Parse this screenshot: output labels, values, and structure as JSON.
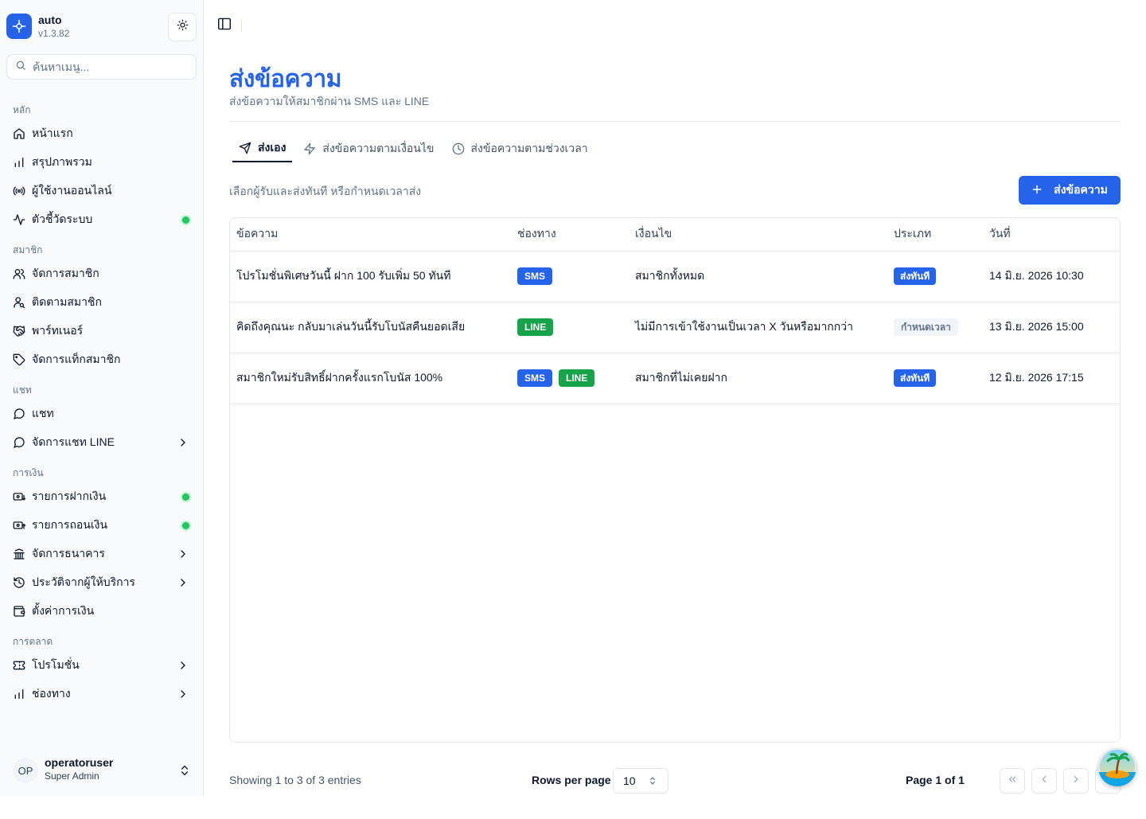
{
  "app": {
    "name": "auto",
    "version": "v1.3.82"
  },
  "search": {
    "placeholder": "ค้นหาเมนู..."
  },
  "sidebar": {
    "sections": [
      {
        "label": "หลัก",
        "items": [
          {
            "label": "หน้าแรก",
            "icon": "home-icon"
          },
          {
            "label": "สรุปภาพรวม",
            "icon": "bar-chart-icon"
          },
          {
            "label": "ผู้ใช้งานออนไลน์",
            "icon": "radio-icon"
          },
          {
            "label": "ตัวชี้วัดระบบ",
            "icon": "activity-icon",
            "status_dot": true
          }
        ]
      },
      {
        "label": "สมาชิก",
        "items": [
          {
            "label": "จัดการสมาชิก",
            "icon": "users-icon"
          },
          {
            "label": "ติดตามสมาชิก",
            "icon": "user-search-icon"
          },
          {
            "label": "พาร์ทเนอร์",
            "icon": "handshake-icon"
          },
          {
            "label": "จัดการแท็กสมาชิก",
            "icon": "tag-icon"
          }
        ]
      },
      {
        "label": "แชท",
        "items": [
          {
            "label": "แชท",
            "icon": "message-circle-icon"
          },
          {
            "label": "จัดการแชท LINE",
            "icon": "message-circle-icon",
            "chevron": true
          }
        ]
      },
      {
        "label": "การเงิน",
        "items": [
          {
            "label": "รายการฝากเงิน",
            "icon": "cash-in-icon",
            "status_dot": true
          },
          {
            "label": "รายการถอนเงิน",
            "icon": "cash-out-icon",
            "status_dot": true
          },
          {
            "label": "จัดการธนาคาร",
            "icon": "bank-icon",
            "chevron": true
          },
          {
            "label": "ประวัติจากผู้ให้บริการ",
            "icon": "history-icon",
            "chevron": true
          },
          {
            "label": "ตั้งค่าการเงิน",
            "icon": "wallet-icon"
          }
        ]
      },
      {
        "label": "การตลาด",
        "items": [
          {
            "label": "โปรโมชั่น",
            "icon": "ticket-icon",
            "chevron": true
          },
          {
            "label": "ช่องทาง",
            "icon": "bar-chart-icon",
            "chevron": true
          }
        ]
      }
    ]
  },
  "user": {
    "initials": "OP",
    "name": "operatoruser",
    "role": "Super Admin"
  },
  "page": {
    "title": "ส่งข้อความ",
    "subtitle": "ส่งข้อความให้สมาชิกผ่าน SMS และ LINE"
  },
  "tabs": [
    {
      "label": "ส่งเอง",
      "icon": "send-icon",
      "active": true
    },
    {
      "label": "ส่งข้อความตามเงื่อนไข",
      "icon": "zap-icon",
      "active": false
    },
    {
      "label": "ส่งข้อความตามช่วงเวลา",
      "icon": "clock-icon",
      "active": false
    }
  ],
  "helper_text": "เลือกผู้รับและส่งทันที หรือกำหนดเวลาส่ง",
  "send_button_label": "ส่งข้อความ",
  "table": {
    "headers": [
      "ข้อความ",
      "ช่องทาง",
      "เงื่อนไข",
      "ประเภท",
      "วันที่"
    ],
    "rows": [
      {
        "message": "โปรโมชั่นพิเศษวันนี้ ฝาก 100 รับเพิ่ม 50 ทันที",
        "channels": [
          "SMS"
        ],
        "condition": "สมาชิกทั้งหมด",
        "type": "ส่งทันที",
        "type_kind": "instant",
        "date": "14 มิ.ย. 2026 10:30"
      },
      {
        "message": "คิดถึงคุณนะ กลับมาเล่นวันนี้รับโบนัสคืนยอดเสีย",
        "channels": [
          "LINE"
        ],
        "condition": "ไม่มีการเข้าใช้งานเป็นเวลา X วันหรือมากกว่า",
        "type": "กำหนดเวลา",
        "type_kind": "scheduled",
        "date": "13 มิ.ย. 2026 15:00"
      },
      {
        "message": "สมาชิกใหม่รับสิทธิ์ฝากครั้งแรกโบนัส 100%",
        "channels": [
          "SMS",
          "LINE"
        ],
        "condition": "สมาชิกที่ไม่เคยฝาก",
        "type": "ส่งทันที",
        "type_kind": "instant",
        "date": "12 มิ.ย. 2026 17:15"
      }
    ]
  },
  "pagination": {
    "showing": "Showing 1 to 3 of 3 entries",
    "rows_per_page_label": "Rows per page",
    "rows_per_page_value": "10",
    "page_info": "Page 1 of 1"
  },
  "colors": {
    "primary": "#2563eb",
    "line_green": "#16a34a",
    "status_dot": "#22c55e"
  }
}
